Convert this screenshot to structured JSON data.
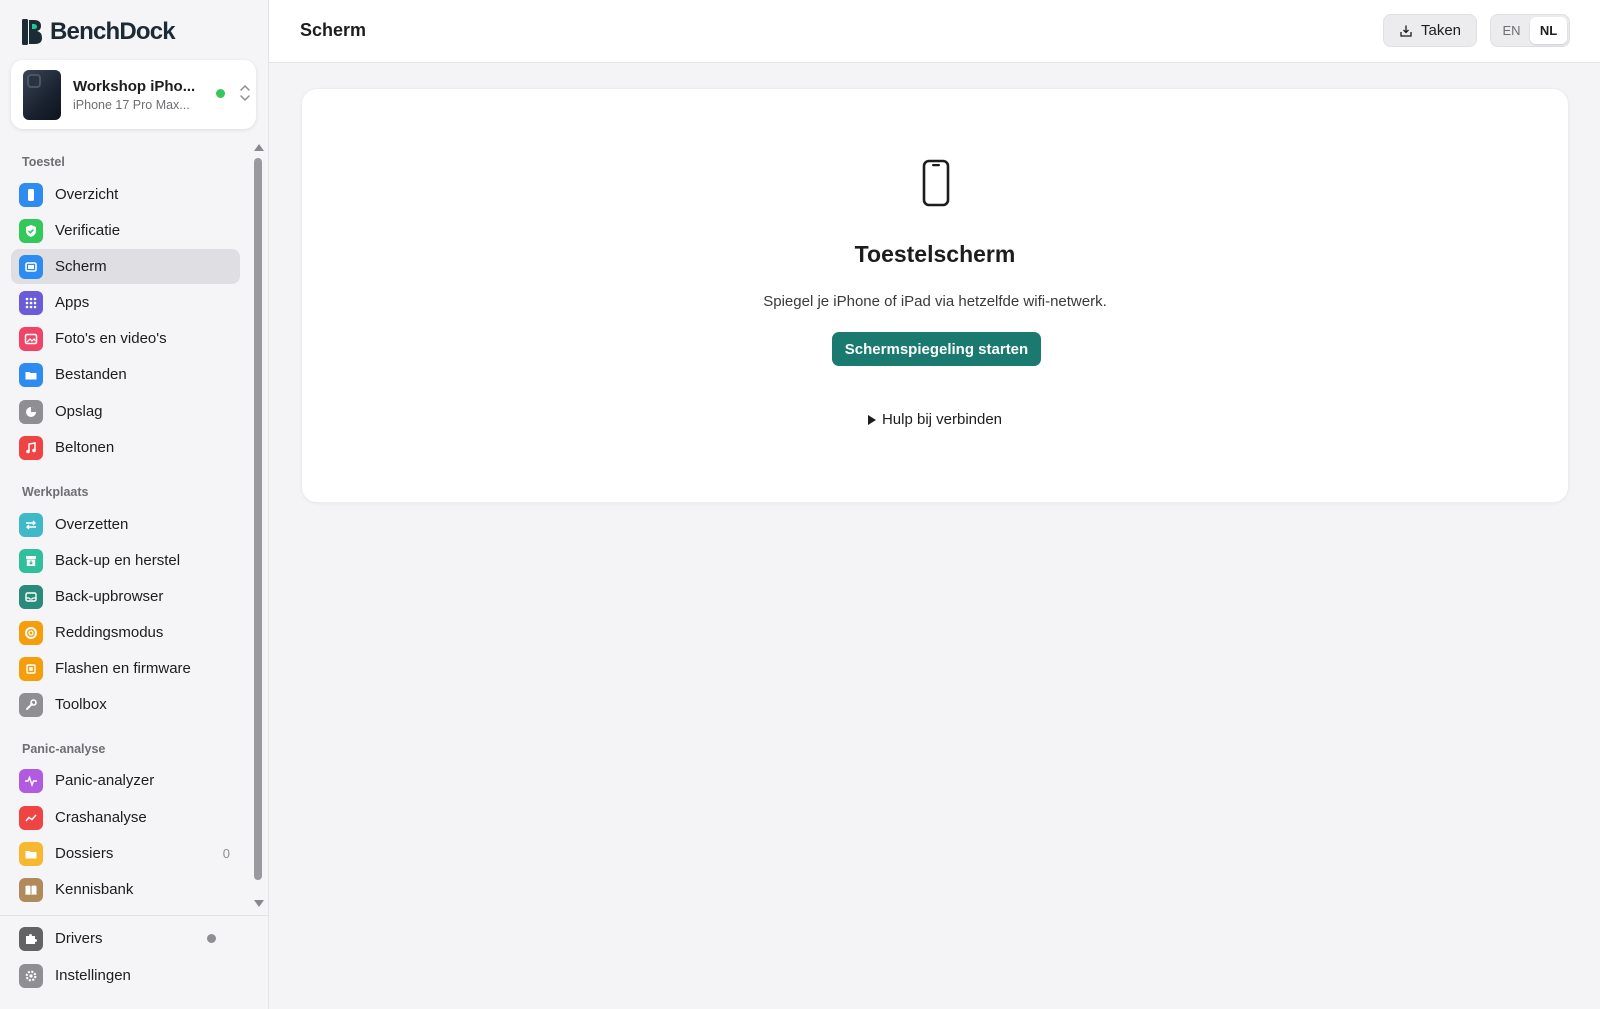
{
  "app": {
    "name_part1": "Bench",
    "name_part2": "Dock"
  },
  "device": {
    "name": "Workshop iPho...",
    "model": "iPhone 17 Pro Max...",
    "status_color": "#34c759"
  },
  "sidebar": {
    "sections": [
      {
        "label": "Toestel"
      },
      {
        "label": "Werkplaats"
      },
      {
        "label": "Panic-analyse"
      }
    ],
    "items": [
      {
        "label": "Overzicht",
        "icon": "phone-icon",
        "color": "#2e8bf0"
      },
      {
        "label": "Verificatie",
        "icon": "shield-check-icon",
        "color": "#34c759"
      },
      {
        "label": "Scherm",
        "icon": "screen-icon",
        "color": "#2e8bf0",
        "active": true
      },
      {
        "label": "Apps",
        "icon": "grid-icon",
        "color": "#6a5bd6"
      },
      {
        "label": "Foto's en video's",
        "icon": "photo-icon",
        "color": "#ef4466"
      },
      {
        "label": "Bestanden",
        "icon": "folder-icon",
        "color": "#2e8bf0"
      },
      {
        "label": "Opslag",
        "icon": "pie-icon",
        "color": "#8e8e93"
      },
      {
        "label": "Beltonen",
        "icon": "music-icon",
        "color": "#ef4444"
      },
      {
        "label": "Overzetten",
        "icon": "transfer-icon",
        "color": "#3fb8c8"
      },
      {
        "label": "Back-up en herstel",
        "icon": "archive-icon",
        "color": "#2fbf9a"
      },
      {
        "label": "Back-upbrowser",
        "icon": "tray-icon",
        "color": "#2a8a7c"
      },
      {
        "label": "Reddingsmodus",
        "icon": "lifebuoy-icon",
        "color": "#f59e0b"
      },
      {
        "label": "Flashen en firmware",
        "icon": "chip-icon",
        "color": "#f59e0b"
      },
      {
        "label": "Toolbox",
        "icon": "wrench-icon",
        "color": "#8e8e93"
      },
      {
        "label": "Panic-analyzer",
        "icon": "pulse-icon",
        "color": "#b05be0"
      },
      {
        "label": "Crashanalyse",
        "icon": "chart-icon",
        "color": "#ef4444"
      },
      {
        "label": "Dossiers",
        "icon": "folder-icon",
        "color": "#f5b82e",
        "count": "0"
      },
      {
        "label": "Kennisbank",
        "icon": "book-icon",
        "color": "#b08a5a"
      }
    ],
    "footer": [
      {
        "label": "Drivers",
        "icon": "puzzle-icon",
        "color": "#636366"
      },
      {
        "label": "Instellingen",
        "icon": "gear-icon",
        "color": "#8e8e93"
      }
    ]
  },
  "header": {
    "title": "Scherm",
    "tasks_label": "Taken",
    "lang": [
      "EN",
      "NL"
    ],
    "lang_active": "NL"
  },
  "main": {
    "title": "Toestelscherm",
    "subtitle": "Spiegel je iPhone of iPad via hetzelfde wifi-netwerk.",
    "button": "Schermspiegeling starten",
    "help": "Hulp bij verbinden"
  },
  "colors": {
    "accent": "#1a7a70"
  }
}
